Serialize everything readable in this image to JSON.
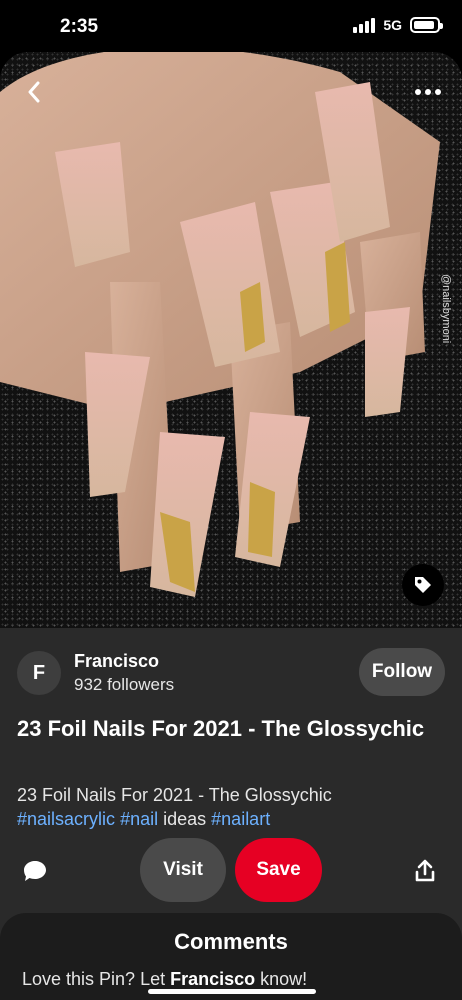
{
  "status": {
    "time": "2:35",
    "network": "5G"
  },
  "image": {
    "watermark": "@nailsbymoni",
    "icons": [
      "back-chevron-icon",
      "more-dots-icon",
      "tag-icon"
    ]
  },
  "creator": {
    "initial": "F",
    "name": "Francisco",
    "followers": "932 followers",
    "follow_label": "Follow"
  },
  "pin": {
    "title": "23 Foil Nails For 2021 - The Glossychic",
    "description": "23 Foil Nails For 2021 - The Glossychic",
    "tags": [
      "#nailsacrylic",
      "#nail",
      "ideas",
      "#nailart"
    ]
  },
  "actions": {
    "visit_label": "Visit",
    "save_label": "Save",
    "icons": [
      "comment-bubble-icon",
      "share-icon"
    ]
  },
  "comments": {
    "title": "Comments",
    "prompt_start": "Love this Pin? Let ",
    "prompt_name": "Francisco",
    "prompt_end": " know!"
  },
  "colors": {
    "save": "#e60023",
    "hashtag": "#6db1ff",
    "panel": "#2a2a2a"
  }
}
